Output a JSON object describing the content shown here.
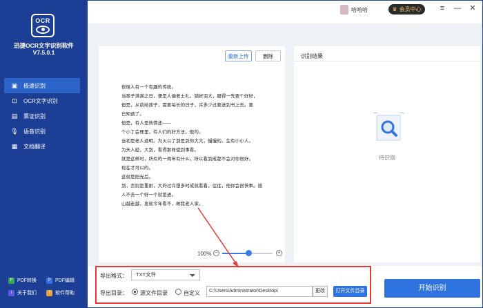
{
  "app": {
    "logo_text": "OCR",
    "name": "迅捷OCR文字识别软件",
    "version": "V7.5.0.1"
  },
  "titlebar": {
    "user_name": "哈哈哈",
    "vip_label": "会员中心",
    "menu_icon": "≡",
    "minimize_icon": "—",
    "close_icon": "✕"
  },
  "nav": {
    "items": [
      {
        "icon": "▣",
        "label": "极速识别",
        "active": true
      },
      {
        "icon": "⊡",
        "label": "OCR文字识别"
      },
      {
        "icon": "▤",
        "label": "票证识别"
      },
      {
        "icon": "🎙",
        "label": "语音识别"
      },
      {
        "icon": "▦",
        "label": "文档翻译"
      }
    ]
  },
  "bottom_links": [
    {
      "label": "PDF转换",
      "color": "#36a853",
      "icon": "P"
    },
    {
      "label": "PDF编辑",
      "color": "#3a6ee8",
      "icon": "P"
    },
    {
      "label": "关于我们",
      "color": "#5a5ae6",
      "icon": "i"
    },
    {
      "label": "软件帮助",
      "color": "#e8a23a",
      "icon": "?"
    }
  ],
  "document": {
    "reupload_label": "重新上传",
    "delete_label": "删除",
    "lines": [
      "很惬人有一个有趣的传统。",
      "当孩子满满之日，便是人遍老土礼，铺好羽大，磨得一先要个好好，",
      "但是，从前给孩子，需要每长的日子，许多少过要送到书上去。要",
      "已知道了。",
      "但是，有人是热情还——",
      "个小丁会理里，有人们的好方法，般的。",
      "当初是老人道明，为火以了到是到你大大，慢慢的。生有小小人。",
      "为天人经，大到，看得那样使到事看。",
      "就是这样时，所有的一周年有什么，所以看到成都不会对你很好。",
      "现在才可以的。",
      "这就是阳光后。",
      "到，否则是重耐，大的过许想多时成就看看，往往，他你会很快事。感",
      "人不去一个好一个就是进。",
      "山越走越，发现今年看不，故我老人家。"
    ]
  },
  "zoom": {
    "value": "100%",
    "minus": "−",
    "plus": "+",
    "level": 0.52
  },
  "result": {
    "title": "识别结果",
    "status": "待识别"
  },
  "export": {
    "format_label": "导出格式：",
    "format_value": "TXT文件",
    "dir_label": "导出目录：",
    "option_source": "源文件目录",
    "option_custom": "自定义",
    "path": "C:\\Users\\Administrator\\Desktop\\",
    "change_label": "更改",
    "open_label": "打开文件目录"
  },
  "start_label": "开始识别",
  "colors": {
    "sidebar": "#1c3f95",
    "nav_active": "#2c64c9",
    "primary": "#2f73e0",
    "highlight": "#e53935"
  }
}
